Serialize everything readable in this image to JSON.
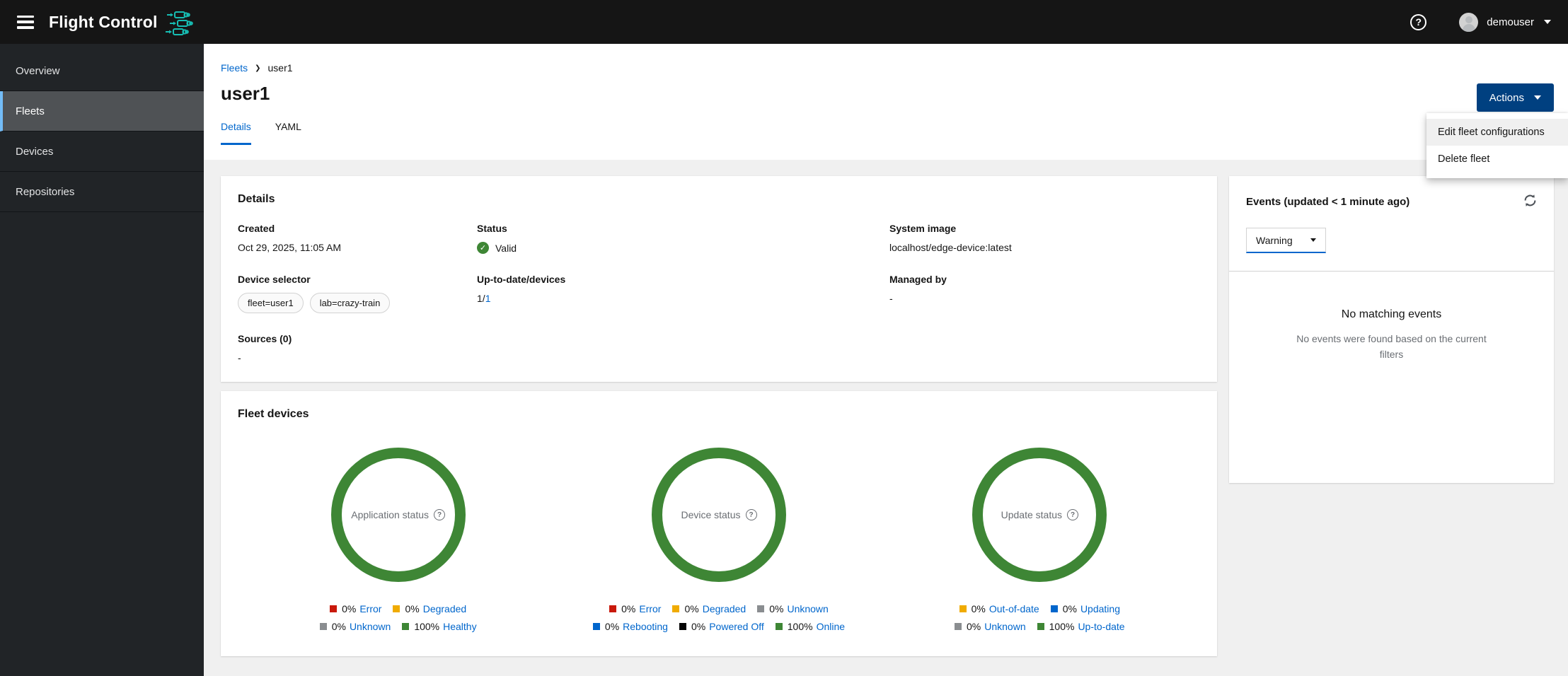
{
  "header": {
    "brand": "Flight Control",
    "user": "demouser"
  },
  "sidebar": {
    "items": [
      {
        "label": "Overview",
        "selected": false
      },
      {
        "label": "Fleets",
        "selected": true
      },
      {
        "label": "Devices",
        "selected": false
      },
      {
        "label": "Repositories",
        "selected": false
      }
    ]
  },
  "breadcrumb": {
    "parent": "Fleets",
    "current": "user1"
  },
  "page": {
    "title": "user1"
  },
  "tabs": [
    {
      "label": "Details",
      "active": true
    },
    {
      "label": "YAML",
      "active": false
    }
  ],
  "actions": {
    "button_label": "Actions",
    "menu": [
      "Edit fleet configurations",
      "Delete fleet"
    ]
  },
  "details": {
    "title": "Details",
    "created_label": "Created",
    "created_value": "Oct 29, 2025, 11:05 AM",
    "status_label": "Status",
    "status_value": "Valid",
    "system_image_label": "System image",
    "system_image_value": "localhost/edge-device:latest",
    "device_selector_label": "Device selector",
    "selectors": [
      "fleet=user1",
      "lab=crazy-train"
    ],
    "up_to_date_label": "Up-to-date/devices",
    "up_to_date_plain": "1/",
    "up_to_date_link": "1",
    "managed_by_label": "Managed by",
    "managed_by_value": "-",
    "sources_label": "Sources (0)",
    "sources_value": "-"
  },
  "fleet_devices": {
    "title": "Fleet devices"
  },
  "events": {
    "title": "Events (updated < 1 minute ago)",
    "filter_value": "Warning",
    "empty_title": "No matching events",
    "empty_body": "No events were found based on the current filters"
  },
  "colors": {
    "accent_link": "#0066CC",
    "primary_button": "#004080",
    "success_green": "#3E8635",
    "warning_gold": "#F0AB00",
    "danger_red": "#C9190B",
    "unknown_gray": "#8A8D90",
    "rebooting_blue": "#0066CC",
    "powered_off_black": "#030303",
    "brand_teal": "#17BDB3",
    "nav_selected_bar": "#73BCF7"
  },
  "chart_data": [
    {
      "type": "pie",
      "title": "Application status",
      "slices": [
        {
          "label": "Error",
          "pct": 0,
          "color": "#C9190B"
        },
        {
          "label": "Degraded",
          "pct": 0,
          "color": "#F0AB00"
        },
        {
          "label": "Unknown",
          "pct": 0,
          "color": "#8A8D90"
        },
        {
          "label": "Healthy",
          "pct": 100,
          "color": "#3E8635"
        }
      ]
    },
    {
      "type": "pie",
      "title": "Device status",
      "slices": [
        {
          "label": "Error",
          "pct": 0,
          "color": "#C9190B"
        },
        {
          "label": "Degraded",
          "pct": 0,
          "color": "#F0AB00"
        },
        {
          "label": "Unknown",
          "pct": 0,
          "color": "#8A8D90"
        },
        {
          "label": "Rebooting",
          "pct": 0,
          "color": "#0066CC"
        },
        {
          "label": "Powered Off",
          "pct": 0,
          "color": "#030303"
        },
        {
          "label": "Online",
          "pct": 100,
          "color": "#3E8635"
        }
      ]
    },
    {
      "type": "pie",
      "title": "Update status",
      "slices": [
        {
          "label": "Out-of-date",
          "pct": 0,
          "color": "#F0AB00"
        },
        {
          "label": "Updating",
          "pct": 0,
          "color": "#0066CC"
        },
        {
          "label": "Unknown",
          "pct": 0,
          "color": "#8A8D90"
        },
        {
          "label": "Up-to-date",
          "pct": 100,
          "color": "#3E8635"
        }
      ]
    }
  ]
}
